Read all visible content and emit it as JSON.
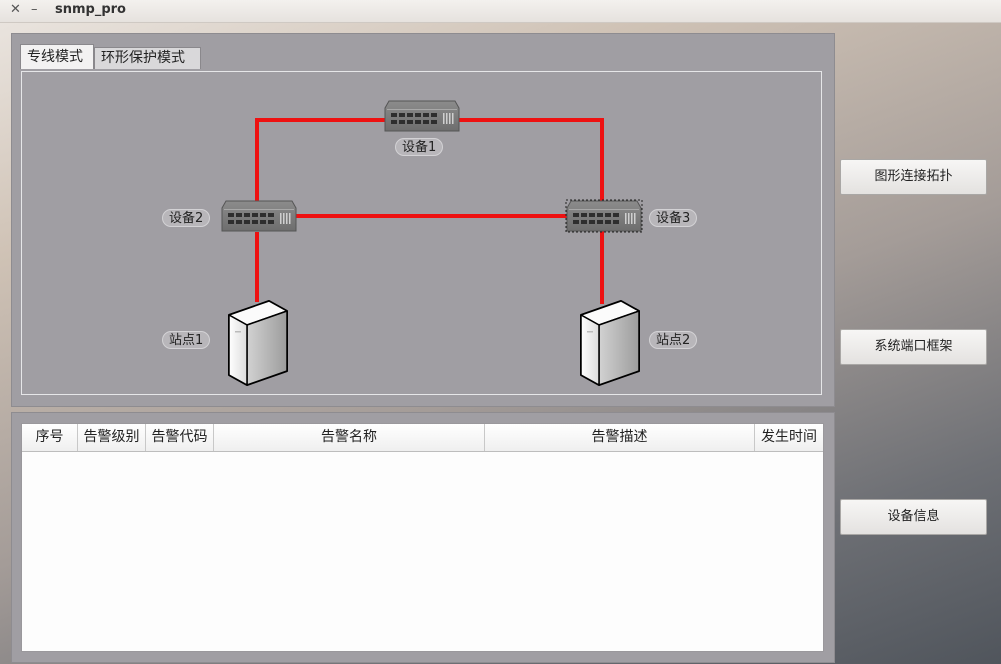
{
  "window": {
    "title": "snmp_pro",
    "close_glyph": "✕",
    "minimize_glyph": "–"
  },
  "tabs": [
    {
      "label": "专线模式",
      "active": true
    },
    {
      "label": "环形保护模式",
      "active": false
    }
  ],
  "topology": {
    "link_color": "#ee1111",
    "devices": [
      {
        "label": "设备1",
        "icon": "network-switch-icon"
      },
      {
        "label": "设备2",
        "icon": "network-switch-icon"
      },
      {
        "label": "设备3",
        "icon": "network-switch-icon",
        "selected": true
      }
    ],
    "stations": [
      {
        "label": "站点1",
        "icon": "server-tower-icon"
      },
      {
        "label": "站点2",
        "icon": "server-tower-icon"
      }
    ]
  },
  "alarm_table": {
    "columns": [
      "序号",
      "告警级别",
      "告警代码",
      "告警名称",
      "告警描述",
      "发生时间"
    ],
    "rows": []
  },
  "side_buttons": {
    "topology": "图形连接拓扑",
    "port_frame": "系统端口框架",
    "device_info": "设备信息"
  }
}
